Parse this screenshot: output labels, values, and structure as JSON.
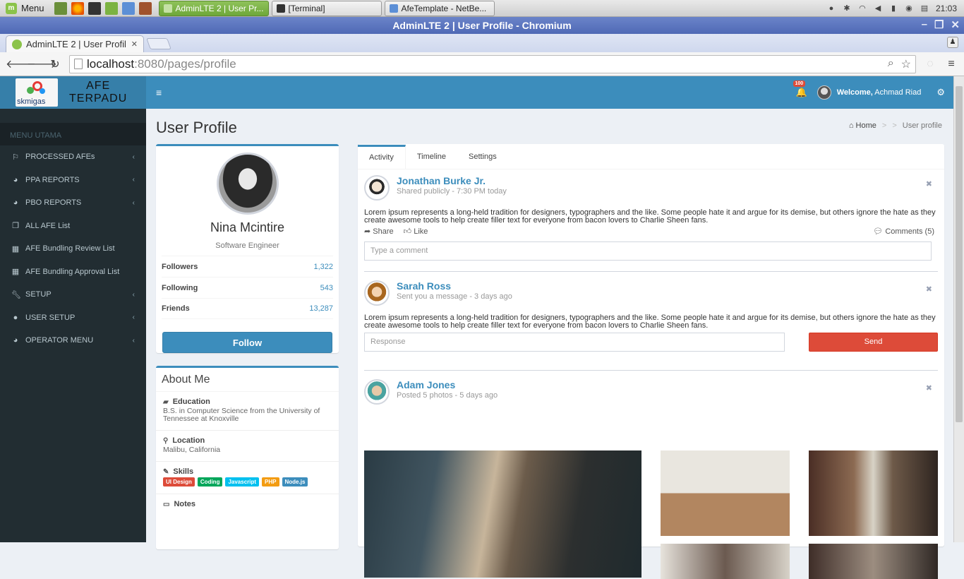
{
  "taskbar": {
    "menu_label": "Menu",
    "tasks": [
      {
        "label": "AdminLTE 2 | User Pr...",
        "active": true
      },
      {
        "label": "[Terminal]",
        "active": false
      },
      {
        "label": "AfeTemplate - NetBe...",
        "active": false
      }
    ],
    "time": "21:03"
  },
  "window": {
    "title": "AdminLTE 2 | User Profile - Chromium"
  },
  "browser": {
    "tab_title": "AdminLTE 2 | User Profil",
    "url_host": "localhost",
    "url_path": ":8080/pages/profile"
  },
  "app": {
    "logo_small": "skmigas",
    "logo_line1": "AFE",
    "logo_line2": "TERPADU",
    "menu_header": "MENU UTAMA",
    "nav": [
      {
        "icon": "flag-icon",
        "label": "PROCESSED AFEs",
        "submenu": true
      },
      {
        "icon": "pie-chart-icon",
        "label": "PPA REPORTS",
        "submenu": true
      },
      {
        "icon": "pie-chart-icon",
        "label": "PBO REPORTS",
        "submenu": true
      },
      {
        "icon": "copy-icon",
        "label": "ALL AFE List",
        "submenu": false
      },
      {
        "icon": "grid-icon",
        "label": "AFE Bundling Review List",
        "submenu": false
      },
      {
        "icon": "grid-icon",
        "label": "AFE Bundling Approval List",
        "submenu": false
      },
      {
        "icon": "wrench-icon",
        "label": "SETUP",
        "submenu": true
      },
      {
        "icon": "user-icon",
        "label": "USER SETUP",
        "submenu": true
      },
      {
        "icon": "pie-chart-icon",
        "label": "OPERATOR MENU",
        "submenu": true
      }
    ],
    "header": {
      "notification_count": "100",
      "welcome_label": "Welcome,",
      "user_name": "Achmad Riad"
    }
  },
  "page": {
    "title": "User Profile",
    "breadcrumb": {
      "home": "Home",
      "current": "User profile"
    },
    "profile": {
      "name": "Nina Mcintire",
      "role": "Software Engineer",
      "stats": [
        {
          "label": "Followers",
          "value": "1,322"
        },
        {
          "label": "Following",
          "value": "543"
        },
        {
          "label": "Friends",
          "value": "13,287"
        }
      ],
      "follow_label": "Follow"
    },
    "about": {
      "title": "About Me",
      "education_label": "Education",
      "education_text": "B.S. in Computer Science from the University of Tennessee at Knoxville",
      "location_label": "Location",
      "location_text": "Malibu, California",
      "skills_label": "Skills",
      "skills": [
        {
          "label": "UI Design",
          "color": "#dd4b39"
        },
        {
          "label": "Coding",
          "color": "#00a65a"
        },
        {
          "label": "Javascript",
          "color": "#00c0ef"
        },
        {
          "label": "PHP",
          "color": "#f39c12"
        },
        {
          "label": "Node.js",
          "color": "#3c8dbc"
        }
      ],
      "notes_label": "Notes"
    },
    "tabs": [
      "Activity",
      "Timeline",
      "Settings"
    ],
    "posts": [
      {
        "user": "Jonathan Burke Jr.",
        "desc": "Shared publicly - 7:30 PM today",
        "text": "Lorem ipsum represents a long-held tradition for designers, typographers and the like. Some people hate it and argue for its demise, but others ignore the hate as they create awesome tools to help create filler text for everyone from bacon lovers to Charlie Sheen fans.",
        "share": "Share",
        "like": "Like",
        "comments": "Comments (5)",
        "comment_placeholder": "Type a comment"
      },
      {
        "user": "Sarah Ross",
        "desc": "Sent you a message - 3 days ago",
        "text": "Lorem ipsum represents a long-held tradition for designers, typographers and the like. Some people hate it and argue for its demise, but others ignore the hate as they create awesome tools to help create filler text for everyone from bacon lovers to Charlie Sheen fans.",
        "response_placeholder": "Response",
        "send_label": "Send"
      },
      {
        "user": "Adam Jones",
        "desc": "Posted 5 photos - 5 days ago"
      }
    ]
  }
}
